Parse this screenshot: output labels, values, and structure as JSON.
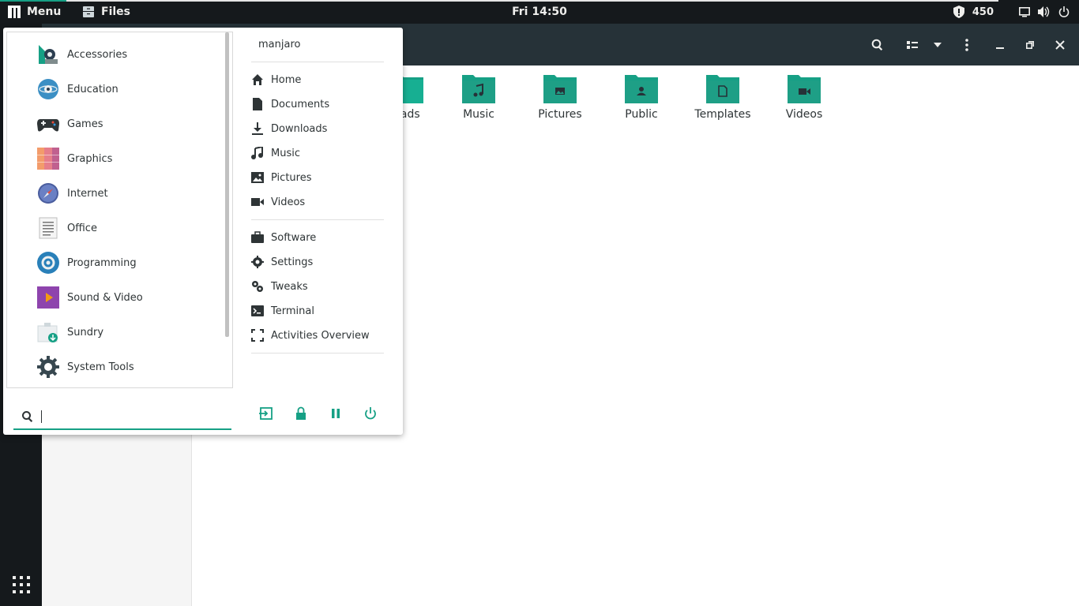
{
  "topbar": {
    "menu_label": "Menu",
    "files_label": "Files",
    "clock": "Fri 14:50",
    "tray_value": "450"
  },
  "files_window": {
    "folders": [
      {
        "label": "oads",
        "icon": "folder-download-icon"
      },
      {
        "label": "Music",
        "icon": "folder-music-icon"
      },
      {
        "label": "Pictures",
        "icon": "folder-pictures-icon"
      },
      {
        "label": "Public",
        "icon": "folder-public-icon"
      },
      {
        "label": "Templates",
        "icon": "folder-templates-icon"
      },
      {
        "label": "Videos",
        "icon": "folder-videos-icon"
      }
    ]
  },
  "menu": {
    "categories": [
      {
        "label": "Accessories",
        "icon": "accessories-icon"
      },
      {
        "label": "Education",
        "icon": "education-icon"
      },
      {
        "label": "Games",
        "icon": "gamepad-icon"
      },
      {
        "label": "Graphics",
        "icon": "graphics-icon"
      },
      {
        "label": "Internet",
        "icon": "compass-icon"
      },
      {
        "label": "Office",
        "icon": "document-icon"
      },
      {
        "label": "Programming",
        "icon": "programming-gear-icon"
      },
      {
        "label": "Sound & Video",
        "icon": "media-play-icon"
      },
      {
        "label": "Sundry",
        "icon": "package-icon"
      },
      {
        "label": "System Tools",
        "icon": "gear-icon"
      }
    ],
    "user": "manjaro",
    "places": [
      {
        "label": "Home",
        "icon": "home-icon"
      },
      {
        "label": "Documents",
        "icon": "file-icon"
      },
      {
        "label": "Downloads",
        "icon": "download-icon"
      },
      {
        "label": "Music",
        "icon": "music-note-icon"
      },
      {
        "label": "Pictures",
        "icon": "image-icon"
      },
      {
        "label": "Videos",
        "icon": "video-camera-icon"
      }
    ],
    "system": [
      {
        "label": "Software",
        "icon": "briefcase-icon"
      },
      {
        "label": "Settings",
        "icon": "settings-gear-icon"
      },
      {
        "label": "Tweaks",
        "icon": "tweaks-icon"
      },
      {
        "label": "Terminal",
        "icon": "terminal-icon"
      },
      {
        "label": "Activities Overview",
        "icon": "activities-icon"
      }
    ],
    "search": {
      "value": "",
      "placeholder": ""
    },
    "accent_color": "#16a085"
  }
}
